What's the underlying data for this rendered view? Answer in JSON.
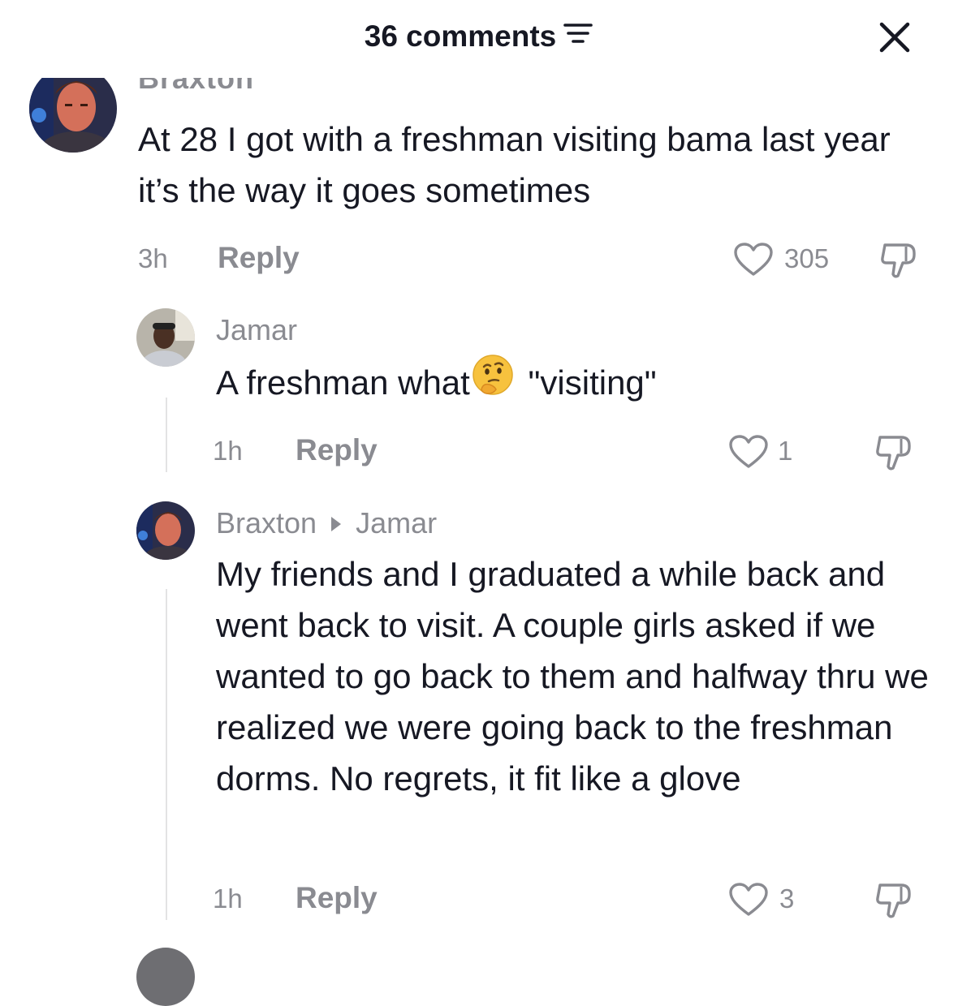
{
  "header": {
    "title": "36 comments"
  },
  "comments": [
    {
      "username": "Braxton",
      "text": "At 28 I got with a freshman visiting bama last year it’s the way it goes sometimes",
      "time": "3h",
      "reply_label": "Reply",
      "likes": "305"
    },
    {
      "username": "Jamar",
      "text_before_emoji": "A freshman what",
      "emoji": "thinking-face",
      "text_after_emoji": "\"visiting\"",
      "time": "1h",
      "reply_label": "Reply",
      "likes": "1"
    },
    {
      "username": "Braxton",
      "reply_to": "Jamar",
      "text": "My friends and I graduated a while back and went back to visit. A couple girls asked if we wanted to go back to them and halfway thru we realized we were going back to the freshman dorms. No regrets, it fit like a glove",
      "time": "1h",
      "reply_label": "Reply",
      "likes": "3"
    }
  ],
  "colors": {
    "text": "#161823",
    "muted": "#8a8b91",
    "thread_line": "#e3e3e4"
  },
  "icons": [
    "sort-icon",
    "close-icon",
    "heart-outline-icon",
    "dislike-icon",
    "thinking-face-emoji"
  ]
}
